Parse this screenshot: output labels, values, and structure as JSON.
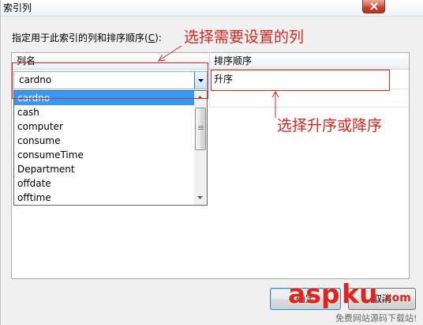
{
  "window": {
    "title": "索引列"
  },
  "instruction": {
    "prefix": "指定用于此索引的列和排序顺序(",
    "accelerator": "C",
    "suffix": "):"
  },
  "grid": {
    "columns": [
      "列名",
      "排序顺序"
    ],
    "rows": [
      {
        "column_name": "cardno",
        "sort_order": "升序"
      }
    ]
  },
  "dropdown": {
    "options": [
      {
        "label": "cardno",
        "highlighted": true
      },
      {
        "label": "cash",
        "highlighted": false
      },
      {
        "label": "computer",
        "highlighted": false
      },
      {
        "label": "consume",
        "highlighted": false
      },
      {
        "label": "consumeTime",
        "highlighted": false
      },
      {
        "label": "Department",
        "highlighted": false
      },
      {
        "label": "offdate",
        "highlighted": false
      },
      {
        "label": "offtime",
        "highlighted": false
      }
    ]
  },
  "annotations": {
    "select_column": "选择需要设置的列",
    "select_order": "选择升序或降序"
  },
  "buttons": {
    "ok_label": "确定",
    "cancel_label": "取消"
  },
  "watermark": {
    "brand_asp": "asp",
    "brand_ku": "ku",
    "domain": ".com",
    "slogan": "免费网站源码下载站!"
  },
  "colors": {
    "annotation_red": "#e3241b",
    "selection_blue": "#3399ff",
    "close_button_red": "#c7402e"
  },
  "icons": {
    "close": "close-icon",
    "combobox_arrow": "chevron-down-icon",
    "scroll_up": "scroll-up-icon",
    "scroll_down": "scroll-down-icon",
    "scroll_grip": "scroll-grip-icon"
  }
}
